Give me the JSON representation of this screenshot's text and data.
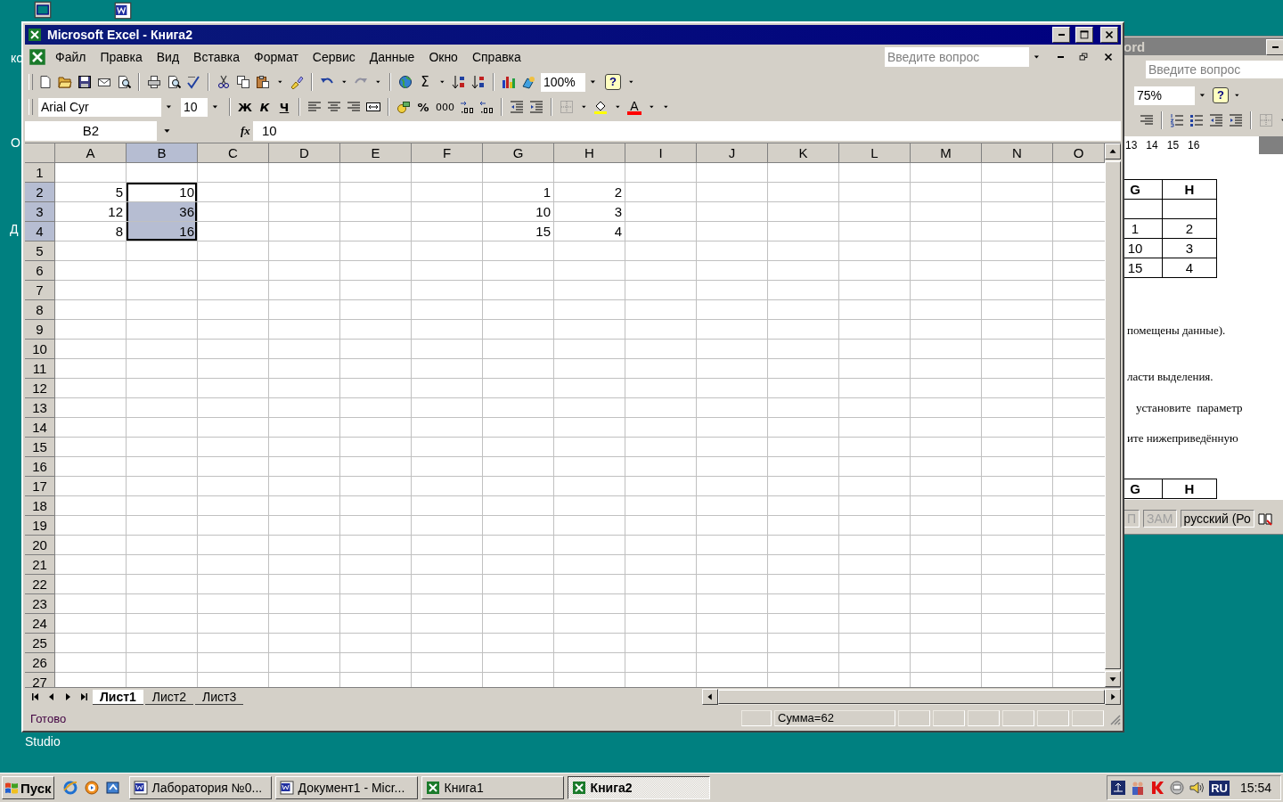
{
  "desktop": {
    "labels": [
      "ко",
      "О",
      "Д",
      "Studio"
    ]
  },
  "word_window": {
    "title": "ord",
    "question_placeholder": "Введите вопрос",
    "zoom": "75%",
    "help_glyph": "?",
    "ruler": [
      "13",
      "14",
      "15",
      "16"
    ],
    "table": {
      "header": [
        "G",
        "H"
      ],
      "rows": [
        [
          null,
          null
        ],
        [
          "1",
          "2"
        ],
        [
          "10",
          "3"
        ],
        [
          "15",
          "4"
        ]
      ]
    },
    "paragraphs": [
      "помещены данные).",
      "ласти выделения.",
      "установите  параметр",
      "ите нижеприведённую"
    ],
    "table2_header": [
      "G",
      "H"
    ],
    "status": [
      {
        "text": "П",
        "disabled": true
      },
      {
        "text": "ЗАМ",
        "disabled": true
      },
      {
        "text": "русский (Ро",
        "disabled": false
      }
    ]
  },
  "excel": {
    "title": "Microsoft Excel - Книга2",
    "menu": [
      "Файл",
      "Правка",
      "Вид",
      "Вставка",
      "Формат",
      "Сервис",
      "Данные",
      "Окно",
      "Справка"
    ],
    "question_placeholder": "Введите вопрос",
    "toolbar": {
      "autosum_glyph": "Σ",
      "zoom": "100%",
      "help_glyph": "?"
    },
    "formatting": {
      "font": "Arial Cyr",
      "size": "10",
      "style_buttons": [
        "Ж",
        "К",
        "Ч"
      ],
      "percent": "%",
      "thousands": "000",
      "font_color_glyph": "A"
    },
    "name_box": "B2",
    "fx": "fx",
    "formula": "10",
    "columns": [
      {
        "label": "A",
        "selected": false
      },
      {
        "label": "B",
        "selected": true
      },
      {
        "label": "C",
        "selected": false
      },
      {
        "label": "D",
        "selected": false
      },
      {
        "label": "E",
        "selected": false
      },
      {
        "label": "F",
        "selected": false
      },
      {
        "label": "G",
        "selected": false
      },
      {
        "label": "H",
        "selected": false
      },
      {
        "label": "I",
        "selected": false
      },
      {
        "label": "J",
        "selected": false
      },
      {
        "label": "K",
        "selected": false
      },
      {
        "label": "L",
        "selected": false
      },
      {
        "label": "M",
        "selected": false
      },
      {
        "label": "N",
        "selected": false
      },
      {
        "label": "O",
        "selected": false
      }
    ],
    "rows": [
      {
        "label": "1",
        "selected": false
      },
      {
        "label": "2",
        "selected": true,
        "cells": [
          {
            "value": "5",
            "selected": false,
            "active": false
          },
          {
            "value": "10",
            "selected": true,
            "active": true
          },
          null,
          null,
          null,
          null,
          {
            "value": "1",
            "selected": false,
            "active": false
          },
          {
            "value": "2",
            "selected": false,
            "active": false
          },
          null,
          null,
          null,
          null,
          null,
          null,
          null
        ]
      },
      {
        "label": "3",
        "selected": true,
        "cells": [
          {
            "value": "12",
            "selected": false,
            "active": false
          },
          {
            "value": "36",
            "selected": true,
            "active": false
          },
          null,
          null,
          null,
          null,
          {
            "value": "10",
            "selected": false,
            "active": false
          },
          {
            "value": "3",
            "selected": false,
            "active": false
          },
          null,
          null,
          null,
          null,
          null,
          null,
          null
        ]
      },
      {
        "label": "4",
        "selected": true,
        "cells": [
          {
            "value": "8",
            "selected": false,
            "active": false
          },
          {
            "value": "16",
            "selected": true,
            "active": false
          },
          null,
          null,
          null,
          null,
          {
            "value": "15",
            "selected": false,
            "active": false
          },
          {
            "value": "4",
            "selected": false,
            "active": false
          },
          null,
          null,
          null,
          null,
          null,
          null,
          null
        ]
      },
      {
        "label": "5",
        "selected": false
      },
      {
        "label": "6",
        "selected": false
      },
      {
        "label": "7",
        "selected": false
      },
      {
        "label": "8",
        "selected": false
      },
      {
        "label": "9",
        "selected": false
      },
      {
        "label": "10",
        "selected": false
      },
      {
        "label": "11",
        "selected": false
      },
      {
        "label": "12",
        "selected": false
      },
      {
        "label": "13",
        "selected": false
      },
      {
        "label": "14",
        "selected": false
      },
      {
        "label": "15",
        "selected": false
      },
      {
        "label": "16",
        "selected": false
      },
      {
        "label": "17",
        "selected": false
      },
      {
        "label": "18",
        "selected": false
      },
      {
        "label": "19",
        "selected": false
      },
      {
        "label": "20",
        "selected": false
      },
      {
        "label": "21",
        "selected": false
      },
      {
        "label": "22",
        "selected": false
      },
      {
        "label": "23",
        "selected": false
      },
      {
        "label": "24",
        "selected": false
      },
      {
        "label": "25",
        "selected": false
      },
      {
        "label": "26",
        "selected": false
      },
      {
        "label": "27",
        "selected": false
      }
    ],
    "sheets": [
      {
        "label": "Лист1",
        "selected": true
      },
      {
        "label": "Лист2",
        "selected": false
      },
      {
        "label": "Лист3",
        "selected": false
      }
    ],
    "status": "Готово",
    "sum": "Сумма=62"
  },
  "taskbar": {
    "start": "Пуск",
    "tasks": [
      {
        "label": "Лаборатория №0...",
        "kind": "word",
        "selected": false
      },
      {
        "label": "Документ1 - Micr...",
        "kind": "word",
        "selected": false
      },
      {
        "label": "Книга1",
        "kind": "excel",
        "selected": false
      },
      {
        "label": "Книга2",
        "kind": "excel",
        "selected": true
      }
    ],
    "language": "RU",
    "time": "15:54"
  }
}
